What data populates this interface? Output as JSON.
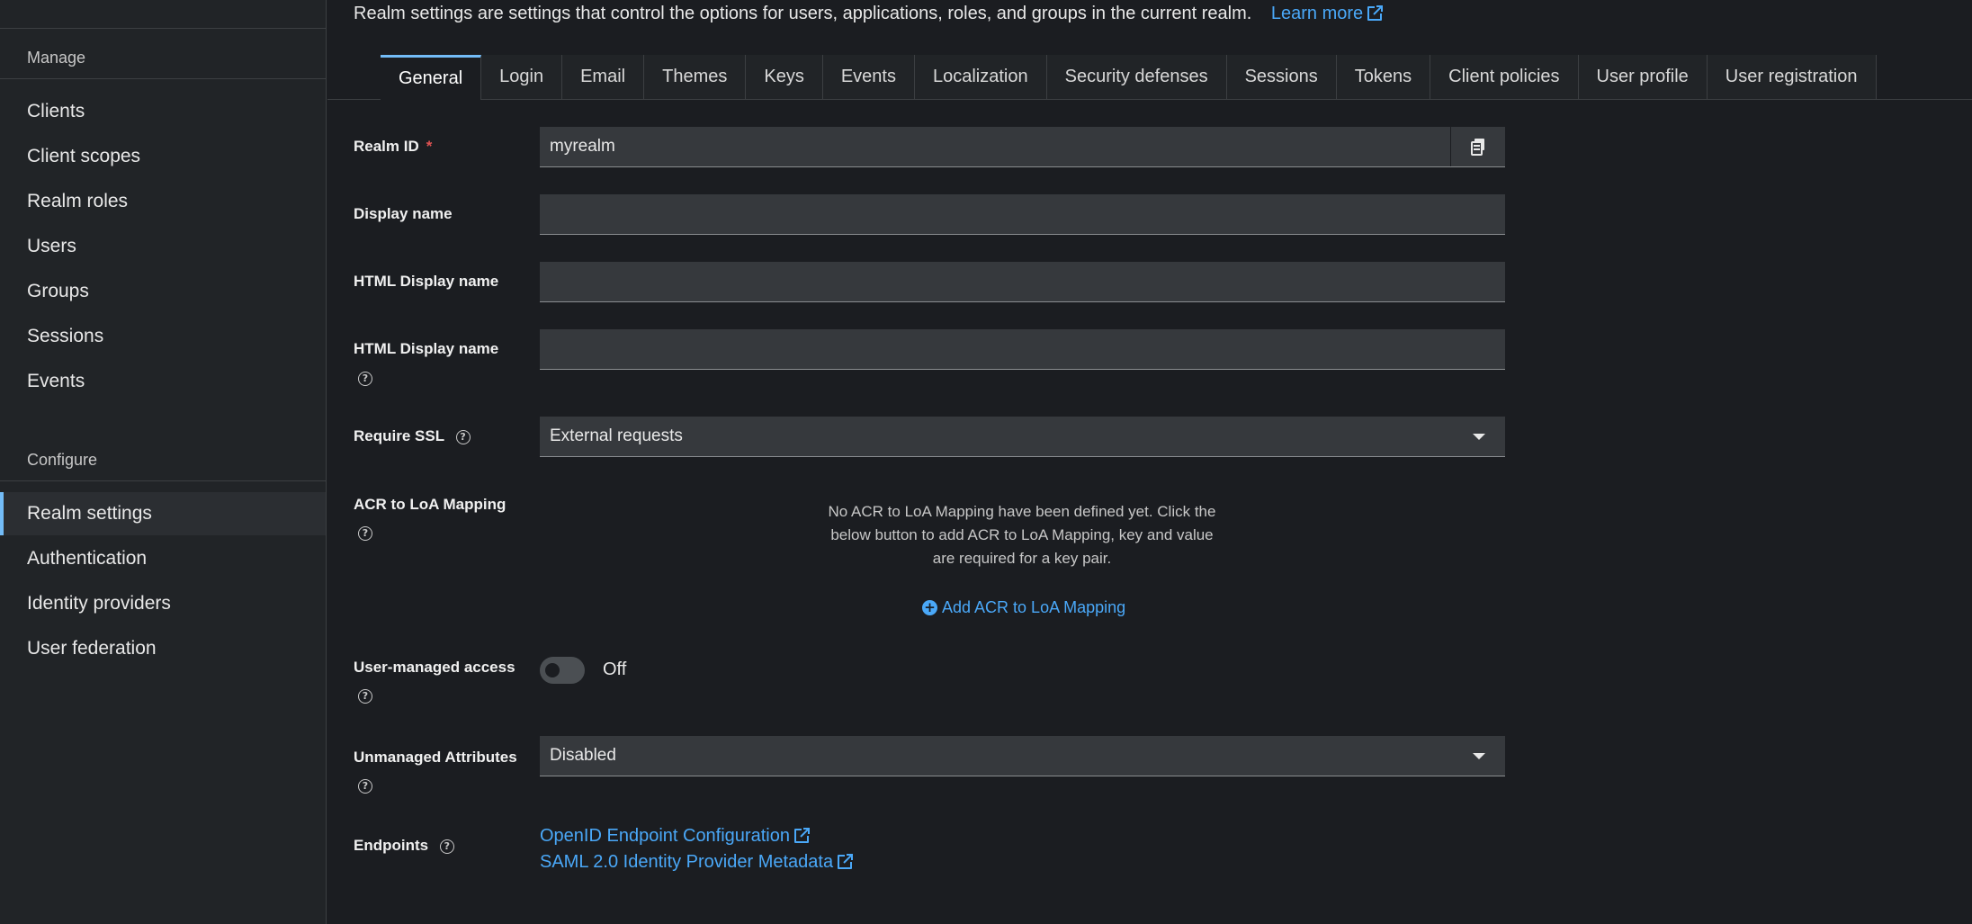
{
  "sidebar": {
    "sections": [
      {
        "title": "Manage",
        "items": [
          "Clients",
          "Client scopes",
          "Realm roles",
          "Users",
          "Groups",
          "Sessions",
          "Events"
        ]
      },
      {
        "title": "Configure",
        "items": [
          "Realm settings",
          "Authentication",
          "Identity providers",
          "User federation"
        ]
      }
    ],
    "active_item": "Realm settings"
  },
  "header": {
    "intro": "Realm settings are settings that control the options for users, applications, roles, and groups in the current realm.",
    "learn_more": "Learn more"
  },
  "tabs": [
    "General",
    "Login",
    "Email",
    "Themes",
    "Keys",
    "Events",
    "Localization",
    "Security defenses",
    "Sessions",
    "Tokens",
    "Client policies",
    "User profile",
    "User registration"
  ],
  "active_tab": "General",
  "form": {
    "realm_id": {
      "label": "Realm ID",
      "required_mark": "*",
      "value": "myrealm"
    },
    "display_name": {
      "label": "Display name",
      "value": ""
    },
    "html_display_name": {
      "label": "HTML Display name",
      "value": ""
    },
    "html_display_name_2": {
      "label": "HTML Display name",
      "value": ""
    },
    "require_ssl": {
      "label": "Require SSL",
      "value": "External requests"
    },
    "acr_loa": {
      "label": "ACR to LoA Mapping",
      "empty_text": "No ACR to LoA Mapping have been defined yet. Click the below button to add ACR to LoA Mapping, key and value are required for a key pair.",
      "add_label": "Add ACR to LoA Mapping"
    },
    "user_managed_access": {
      "label": "User-managed access",
      "state": "Off"
    },
    "unmanaged_attributes": {
      "label": "Unmanaged Attributes",
      "value": "Disabled"
    },
    "endpoints": {
      "label": "Endpoints",
      "links": [
        "OpenID Endpoint Configuration",
        "SAML 2.0 Identity Provider Metadata"
      ]
    }
  },
  "colors": {
    "accent": "#73bcf7",
    "link": "#4aa8f8",
    "background": "#1b1d21",
    "sidebar": "#212427"
  }
}
